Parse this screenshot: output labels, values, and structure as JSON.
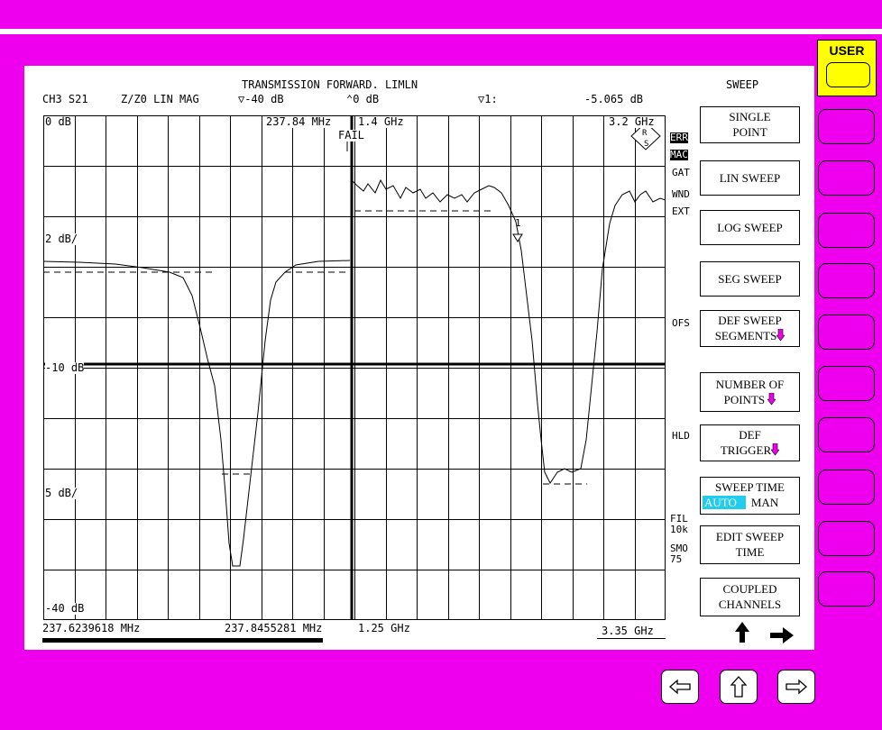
{
  "header": {
    "title": "TRANSMISSION FORWARD. LIMLN",
    "channel": "CH3 S21",
    "format": "Z/Z0 LIN MAG",
    "ref_level": "▽-40 dB",
    "ref_pos": "0 dB",
    "marker_label": "▽1:",
    "marker_value": "-5.065 dB",
    "softkey_menu_title": "SWEEP"
  },
  "plot": {
    "y_top_label": "0 dB",
    "marker_freq": "237.84 MHz",
    "seg2_start": "1.4 GHz",
    "seg2_stop": "3.2 GHz",
    "fail_label": "FAIL",
    "y_label_2": "2 dB/",
    "y_label_ref": "-10 dB",
    "y_label_5": "5 dB/",
    "y_bottom_label": "-40 dB",
    "marker_num": "1",
    "rs_logo": "R S"
  },
  "bottom_axis": {
    "start": "237.6239618 MHz",
    "mid": "237.8455281 MHz",
    "mid2": "1.25 GHz",
    "stop": "3.35 GHz",
    "sweep_progress": 0.45
  },
  "status": {
    "err": "ERR",
    "mac": "MAC",
    "gat": "GAT",
    "wnd": "WND",
    "ext": "EXT",
    "ofs": "OFS",
    "hld": "HLD",
    "fil": "FIL",
    "fil_value": "10k",
    "smo": "SMO",
    "smo_value": "75"
  },
  "softkeys": {
    "single_point_1": "SINGLE",
    "single_point_2": "POINT",
    "lin_sweep": "LIN SWEEP",
    "log_sweep": "LOG SWEEP",
    "seg_sweep": "SEG SWEEP",
    "def_sweep_1": "DEF SWEEP",
    "def_sweep_2": "SEGMENTS",
    "num_points_1": "NUMBER OF",
    "num_points_2": "POINTS",
    "def_trigger_1": "DEF",
    "def_trigger_2": "TRIGGER",
    "sweep_time_1": "SWEEP TIME",
    "sweep_time_auto": "AUTO",
    "sweep_time_man": "MAN",
    "edit_sweep_1": "EDIT SWEEP",
    "edit_sweep_2": "TIME",
    "coupled_1": "COUPLED",
    "coupled_2": "CHANNELS"
  },
  "user_key": {
    "label": "USER"
  },
  "colors": {
    "background": "#ee00ee",
    "user_key": "#ffff00",
    "highlight": "#22ccee",
    "submenu_arrow": "#ee00ee"
  }
}
